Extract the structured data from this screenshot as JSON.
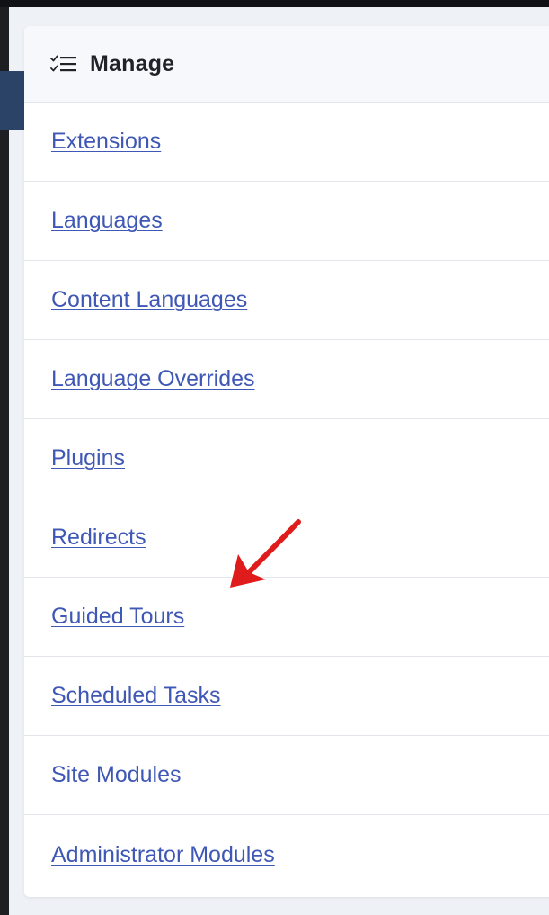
{
  "panel": {
    "title": "Manage",
    "title_icon": "checklist-icon",
    "items": [
      {
        "label": "Extensions"
      },
      {
        "label": "Languages"
      },
      {
        "label": "Content Languages"
      },
      {
        "label": "Language Overrides"
      },
      {
        "label": "Plugins"
      },
      {
        "label": "Redirects"
      },
      {
        "label": "Guided Tours"
      },
      {
        "label": "Scheduled Tasks"
      },
      {
        "label": "Site Modules"
      },
      {
        "label": "Administrator Modules"
      }
    ]
  },
  "colors": {
    "link": "#3f57b5",
    "annotation_arrow": "#e01b1b",
    "side_tab": "#2c4368"
  }
}
